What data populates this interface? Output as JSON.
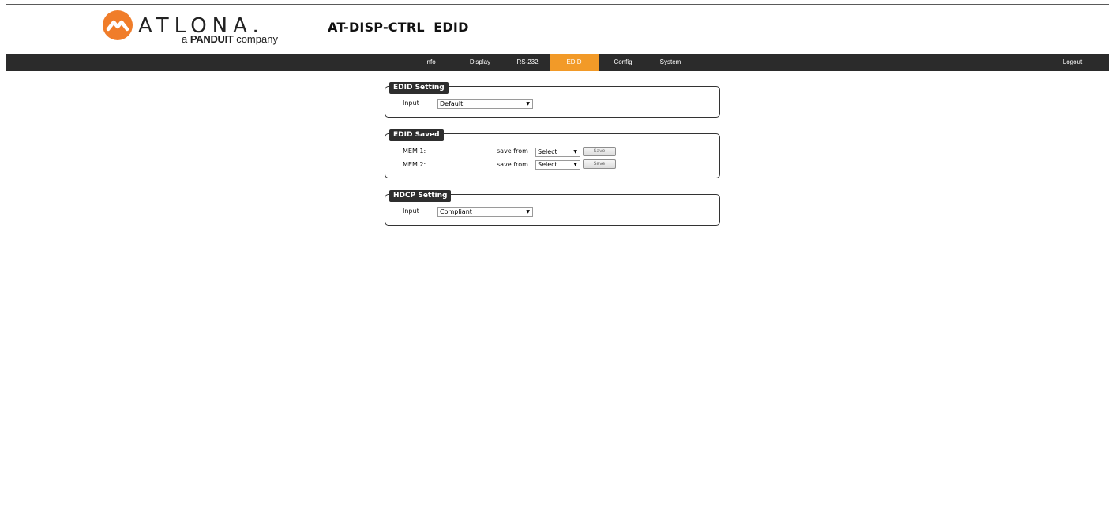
{
  "brand": {
    "wordmark": "ATLONA.",
    "tagline_prefix": "a",
    "tagline_brand": "PANDUIT",
    "tagline_suffix": "company",
    "accent_color": "#f07d2a"
  },
  "page": {
    "title": "AT-DISP-CTRL  EDID"
  },
  "nav": {
    "items": [
      {
        "label": "Info"
      },
      {
        "label": "Display"
      },
      {
        "label": "RS-232"
      },
      {
        "label": "EDID"
      },
      {
        "label": "Config"
      },
      {
        "label": "System"
      }
    ],
    "active": "EDID",
    "active_color": "#f29a28",
    "logout": "Logout"
  },
  "edid_setting": {
    "legend": "EDID Setting",
    "input_label": "Input",
    "input_value": "Default"
  },
  "edid_saved": {
    "legend": "EDID Saved",
    "rows": [
      {
        "label": "MEM 1:",
        "save_from": "save from",
        "select_value": "Select",
        "button": "Save"
      },
      {
        "label": "MEM 2:",
        "save_from": "save from",
        "select_value": "Select",
        "button": "Save"
      }
    ]
  },
  "hdcp_setting": {
    "legend": "HDCP Setting",
    "input_label": "Input",
    "input_value": "Compliant"
  }
}
